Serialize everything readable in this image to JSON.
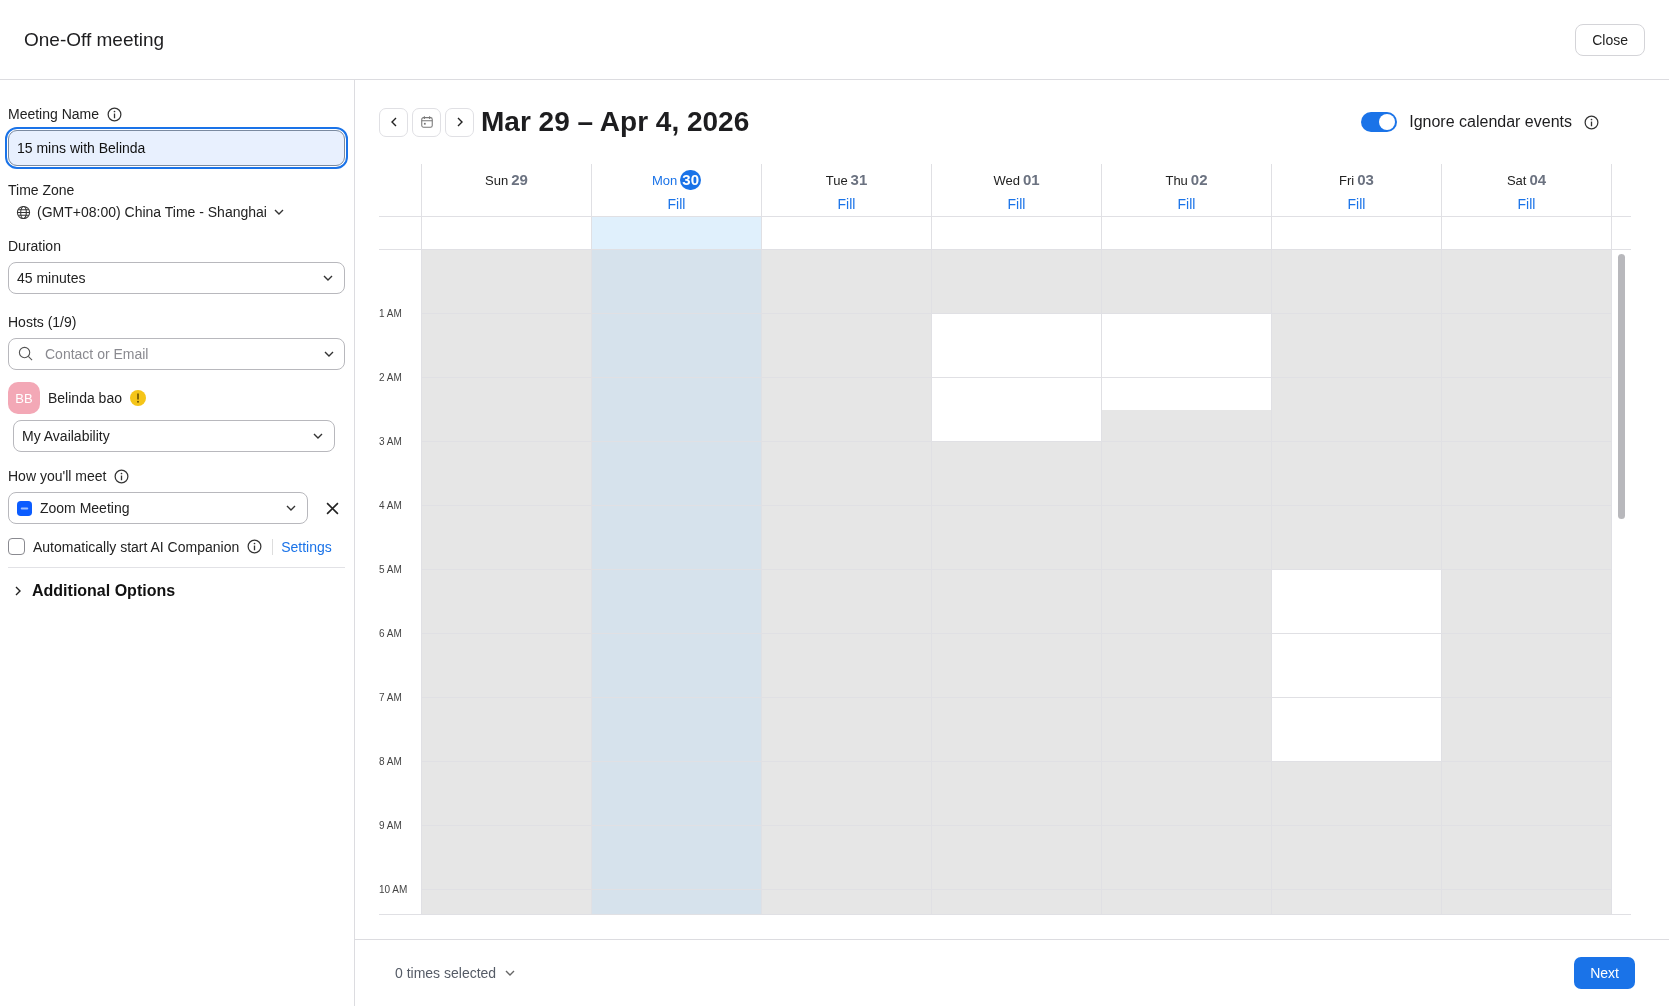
{
  "window": {
    "title": "One-Off meeting",
    "close_button": "Close"
  },
  "form": {
    "meeting_name": {
      "label": "Meeting Name",
      "value": "15 mins with Belinda"
    },
    "time_zone": {
      "label": "Time Zone",
      "value": "(GMT+08:00) China Time - Shanghai"
    },
    "duration": {
      "label": "Duration",
      "value": "45 minutes"
    },
    "hosts": {
      "label": "Hosts (1/9)",
      "placeholder": "Contact or Email",
      "members": [
        {
          "initials": "BB",
          "name": "Belinda bao",
          "warning": true,
          "availability": "My Availability"
        }
      ]
    },
    "meet": {
      "label": "How you'll meet",
      "value": "Zoom Meeting"
    },
    "ai_companion": {
      "label": "Automatically start AI Companion",
      "checked": false,
      "link": "Settings"
    },
    "additional_options": {
      "label": "Additional Options",
      "expanded": false
    }
  },
  "calendar": {
    "range": "Mar 29 – Apr 4, 2026",
    "ignore_events": {
      "label": "Ignore calendar events",
      "on": true
    },
    "days": [
      {
        "weekday": "Sun",
        "date": "29",
        "selected": false,
        "open": [
          false,
          false,
          false,
          false,
          false,
          false,
          false,
          false,
          false,
          false,
          false,
          false,
          false,
          false,
          false,
          false,
          false,
          false,
          false,
          false,
          false
        ]
      },
      {
        "weekday": "Mon",
        "date": "30",
        "selected": true,
        "fill": "Fill",
        "open": [
          false,
          false,
          false,
          false,
          false,
          false,
          false,
          false,
          false,
          false,
          false,
          false,
          false,
          false,
          false,
          false,
          false,
          false,
          false,
          false,
          false
        ]
      },
      {
        "weekday": "Tue",
        "date": "31",
        "selected": false,
        "fill": "Fill",
        "open": [
          false,
          false,
          false,
          false,
          false,
          false,
          false,
          false,
          false,
          false,
          false,
          false,
          false,
          false,
          false,
          false,
          false,
          false,
          false,
          false,
          false
        ]
      },
      {
        "weekday": "Wed",
        "date": "01",
        "selected": false,
        "fill": "Fill",
        "open": [
          false,
          false,
          true,
          true,
          true,
          true,
          false,
          false,
          false,
          false,
          false,
          false,
          false,
          false,
          false,
          false,
          false,
          false,
          false,
          false,
          false
        ]
      },
      {
        "weekday": "Thu",
        "date": "02",
        "selected": false,
        "fill": "Fill",
        "open": [
          false,
          false,
          true,
          true,
          true,
          false,
          false,
          false,
          false,
          false,
          false,
          false,
          false,
          false,
          false,
          false,
          false,
          false,
          false,
          false,
          false
        ]
      },
      {
        "weekday": "Fri",
        "date": "03",
        "selected": false,
        "fill": "Fill",
        "open": [
          false,
          false,
          false,
          false,
          false,
          false,
          false,
          false,
          false,
          false,
          true,
          true,
          true,
          true,
          true,
          true,
          false,
          false,
          false,
          false,
          false
        ]
      },
      {
        "weekday": "Sat",
        "date": "04",
        "selected": false,
        "fill": "Fill",
        "open": [
          false,
          false,
          false,
          false,
          false,
          false,
          false,
          false,
          false,
          false,
          false,
          false,
          false,
          false,
          false,
          false,
          false,
          false,
          false,
          false,
          false
        ]
      }
    ],
    "hours": [
      "1 AM",
      "2 AM",
      "3 AM",
      "4 AM",
      "5 AM",
      "6 AM",
      "7 AM",
      "8 AM",
      "9 AM",
      "10 AM"
    ]
  },
  "footer": {
    "selection": "0 times selected",
    "next_button": "Next"
  }
}
